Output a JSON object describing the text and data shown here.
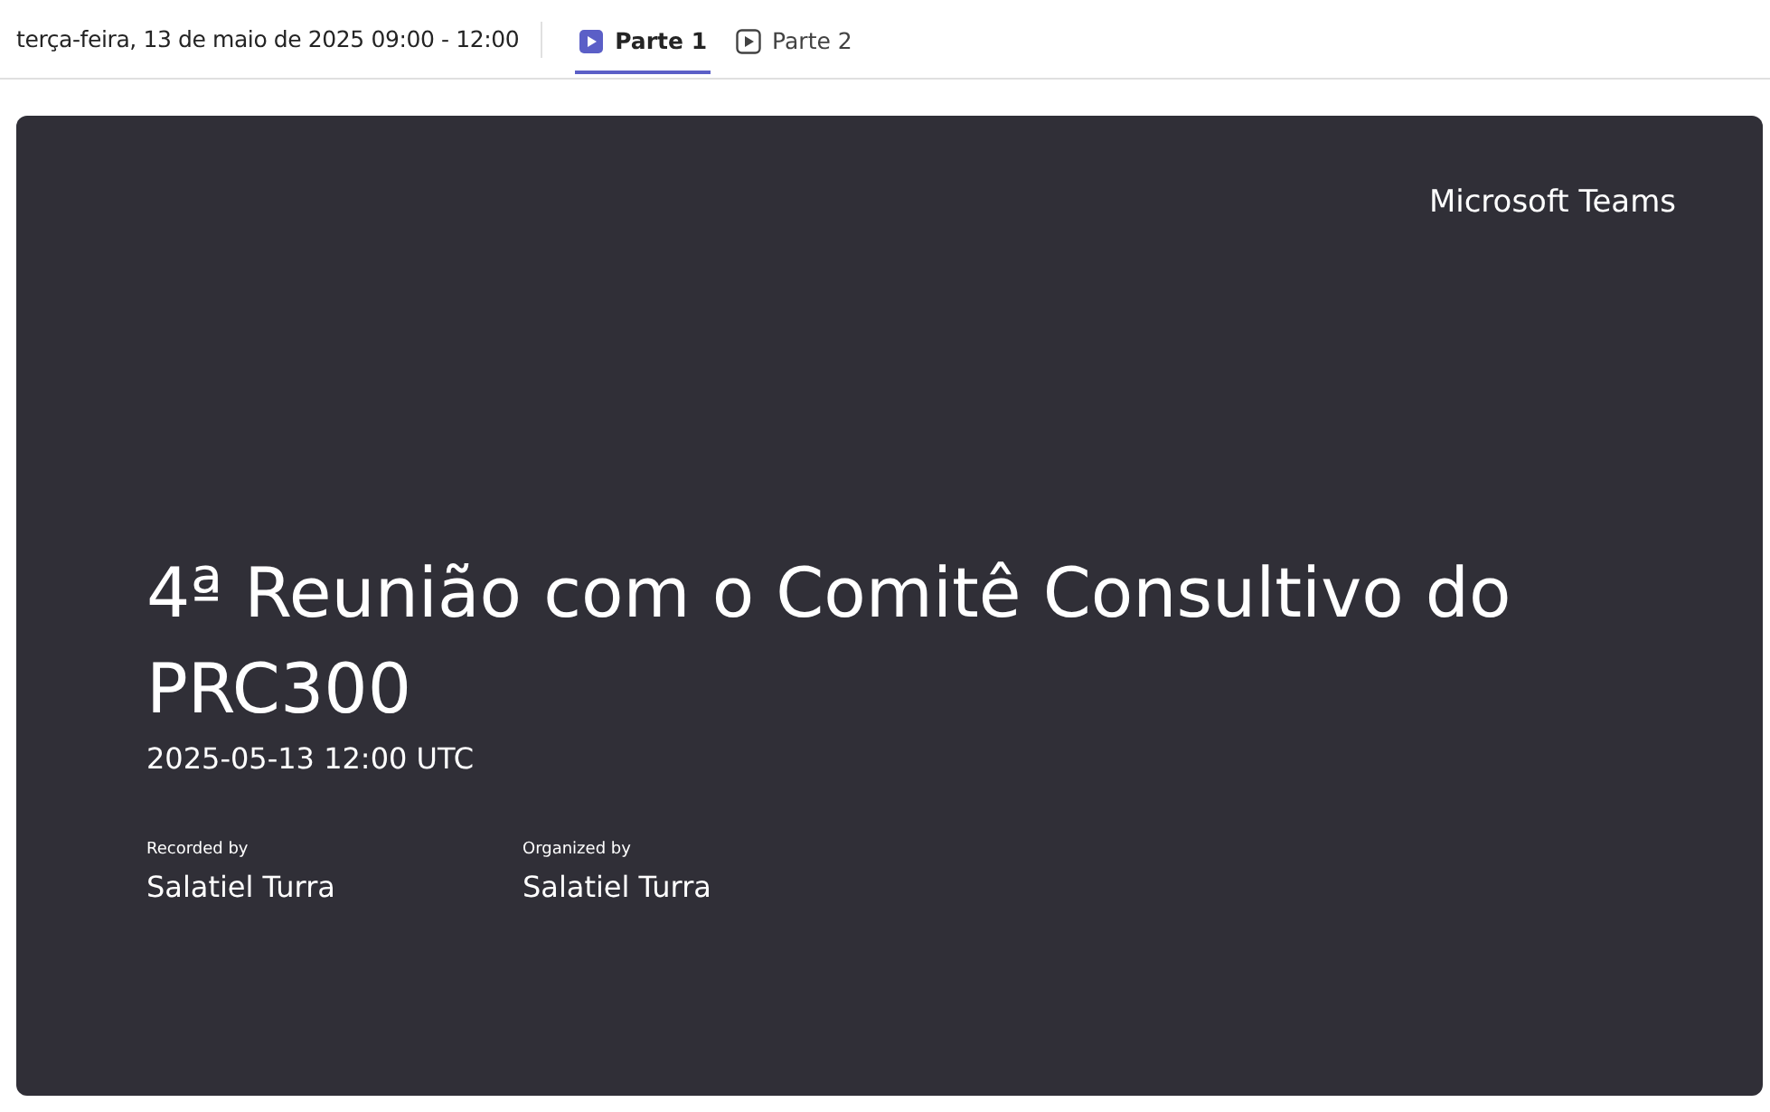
{
  "header": {
    "date": "terça-feira, 13 de maio de 2025 09:00 - 12:00"
  },
  "tabs": [
    {
      "label": "Parte 1",
      "selected": true
    },
    {
      "label": "Parte 2",
      "selected": false
    }
  ],
  "recording": {
    "brand": "Microsoft Teams",
    "title": "4ª Reunião com o Comitê Consultivo do PRC300",
    "timestamp": "2025-05-13 12:00 UTC",
    "people": [
      {
        "role": "Recorded by",
        "name": "Salatiel Turra"
      },
      {
        "role": "Organized by",
        "name": "Salatiel Turra"
      }
    ]
  }
}
